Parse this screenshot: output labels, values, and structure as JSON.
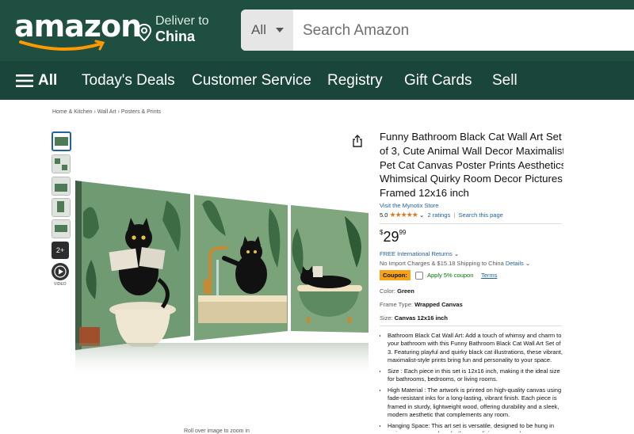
{
  "header": {
    "logo_text": "amazon",
    "deliver_line1": "Deliver to",
    "deliver_line2": "China",
    "search_category": "All",
    "search_placeholder": "Search Amazon"
  },
  "nav": {
    "all_label": "All",
    "items": [
      "Today's Deals",
      "Customer Service",
      "Registry",
      "Gift Cards",
      "Sell"
    ]
  },
  "breadcrumb": "Home & Kitchen › Wall Art › Posters & Prints",
  "thumbnails": {
    "more_label": "2+",
    "video_label": "VIDEO"
  },
  "image_hint": "Roll over image to zoom in",
  "product": {
    "title_lines": [
      "Funny Bathroom Black Cat Wall Art Set",
      "of 3, Cute Animal Wall Decor Maximalist",
      "Pet Cat Canvas Poster Prints Aesthetics",
      "Whimsical Quirky Room Decor Pictures",
      "Framed 12x16 inch"
    ],
    "store": "Visit the Mynotix Store",
    "rating_value": "5.0",
    "stars": "★★★★★",
    "ratings_count": "2 ratings",
    "search_page": "Search this page",
    "price_symbol": "$",
    "price_whole": "29",
    "price_fraction": "99",
    "free_returns": "FREE International Returns",
    "import_charges": "No Import Charges & $15.18 Shipping to China",
    "details": "Details",
    "coupon_label": "Coupon:",
    "coupon_text": "Apply 5% coupon",
    "coupon_terms": "Terms",
    "color_label": "Color:",
    "color_value": "Green",
    "frame_label": "Frame Type:",
    "frame_value": "Wrapped Canvas",
    "size_label": "Size:",
    "size_value": "Canvas 12x16 inch",
    "bullets": [
      "Bathroom Black Cat Wall Art: Add a touch of whimsy and charm to your bathroom with this Funny Bathroom Black Cat Wall Art Set of 3. Featuring playful and quirky black cat illustrations, these vibrant, maximalist-style prints bring fun and personality to your space.",
      "Size : Each piece in this set is 12x16 inch, making it the ideal size for bathrooms, bedrooms, or living rooms.",
      "High Material : The artwork is printed on high-quality canvas using fade-resistant inks for a long-lasting, vibrant finish. Each piece is framed in sturdy, lightweight wood, offering durability and a sleek, modern aesthetic that complements any room.",
      "Hanging Space: This art set is versatile, designed to be hung in various spaces such as bathrooms, living rooms, dorms, or"
    ]
  },
  "colors": {
    "header_bg": "#1f4f40",
    "nav_bg": "#1a453a",
    "link": "#2162a1",
    "star": "#de7921",
    "coupon_badge": "#f7a21b",
    "coupon_green": "#007600"
  }
}
